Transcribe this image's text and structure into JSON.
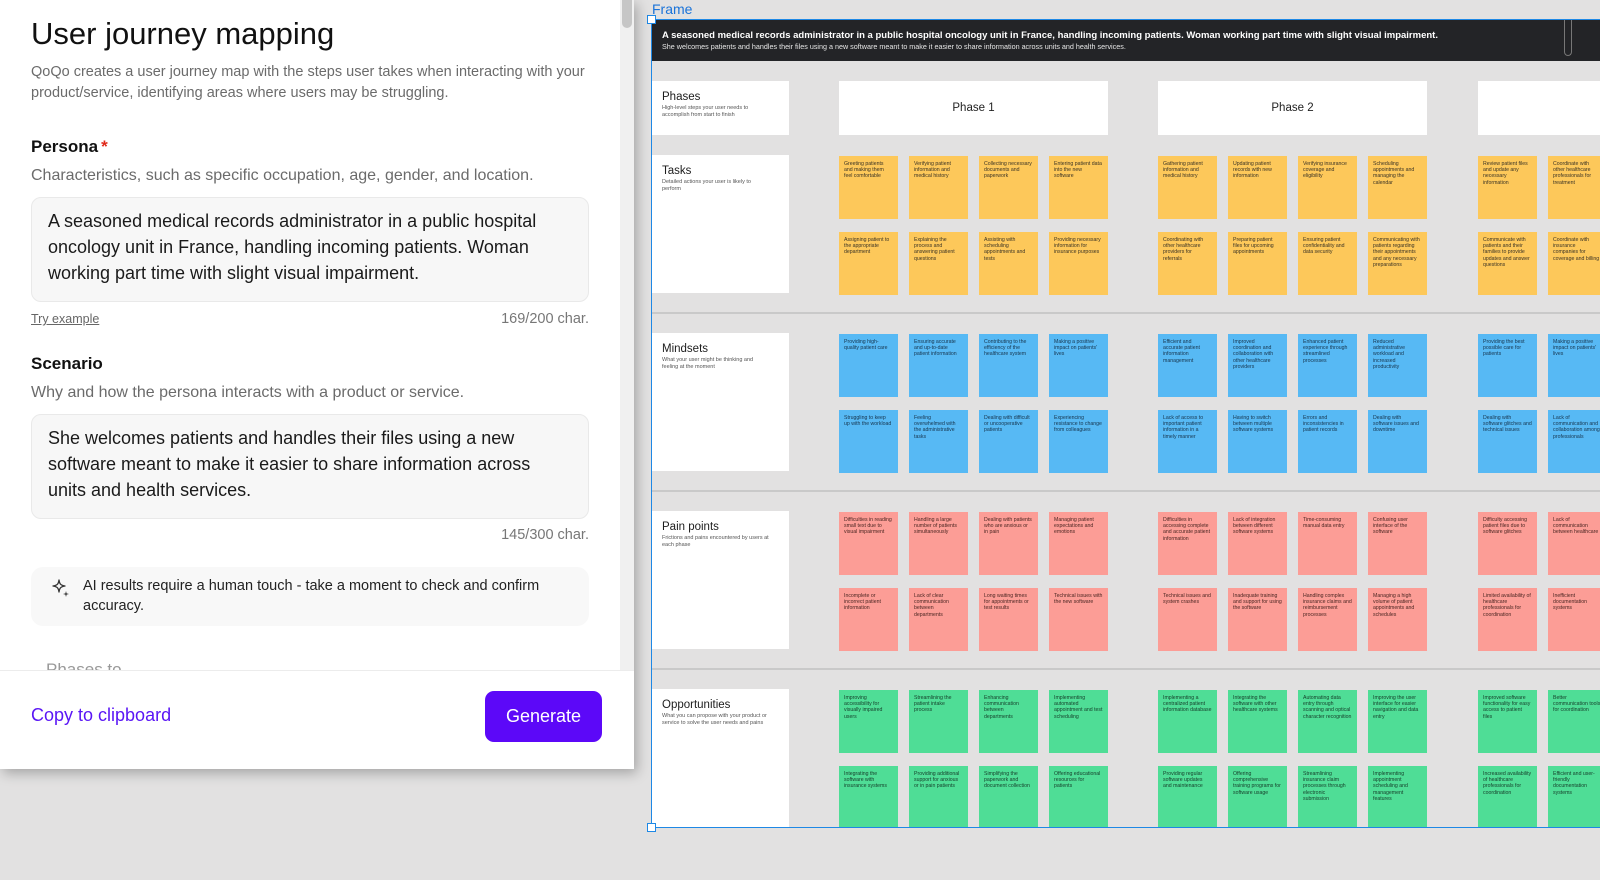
{
  "panel": {
    "title": "User journey mapping",
    "subtitle": "QoQo creates a user journey map with the steps user takes when interacting with your product/service, identifying areas where users may be struggling.",
    "persona": {
      "label": "Persona",
      "required_mark": "*",
      "description": "Characteristics, such as specific occupation, age, gender, and location.",
      "value": "A seasoned medical records administrator in a public hospital oncology unit in France, handling incoming patients. Woman working part time with slight visual impairment.",
      "try_example": "Try example",
      "counter": "169/200 char."
    },
    "scenario": {
      "label": "Scenario",
      "description": "Why and how the persona interacts with a product or service.",
      "value": "She welcomes patients and handles their files using a new software meant to make it easier to share information across units and health services.",
      "counter": "145/300 char."
    },
    "ai_note": "AI results require a human touch - take a moment to check and confirm accuracy.",
    "next_section_cutoff": "Phases to ...",
    "footer": {
      "copy_label": "Copy to clipboard",
      "generate_label": "Generate"
    },
    "colors": {
      "accent": "#5c08f8",
      "required": "#e0281a"
    }
  },
  "canvas": {
    "frame_label": "Frame",
    "banner": {
      "persona": "A seasoned medical records administrator in a public hospital oncology unit in France, handling incoming patients. Woman working part time with slight visual impairment.",
      "scenario": "She welcomes patients and handles their files using a new software meant to make it easier to share information across units and health services."
    },
    "lanes": {
      "phases": {
        "title": "Phases",
        "desc": "High-level steps your user needs to accomplish from start to finish"
      },
      "tasks": {
        "title": "Tasks",
        "desc": "Detailed actions your user is likely to perform"
      },
      "mindsets": {
        "title": "Mindsets",
        "desc": "What your user might be thinking and feeling at the moment"
      },
      "pains": {
        "title": "Pain points",
        "desc": "Frictions and pains encountered by users at each phase"
      },
      "opps": {
        "title": "Opportunities",
        "desc": "What you can propose with your product or service to solve the user needs and pains"
      }
    },
    "phases": [
      "Phase 1",
      "Phase 2",
      ""
    ],
    "stickies": {
      "tasks": [
        [
          "Greeting patients and making them feel comfortable",
          "Verifying patient information and medical history",
          "Collecting necessary documents and paperwork",
          "Entering patient data into the new software",
          "Assigning patient to the appropriate department",
          "Explaining the process and answering patient questions",
          "Assisting with scheduling appointments and tests",
          "Providing necessary information for insurance purposes"
        ],
        [
          "Gathering patient information and medical history",
          "Updating patient records with new information",
          "Verifying insurance coverage and eligibility",
          "Scheduling appointments and managing the calendar",
          "Coordinating with other healthcare providers for referrals",
          "Preparing patient files for upcoming appointments",
          "Ensuring patient confidentiality and data security",
          "Communicating with patients regarding their appointments and any necessary preparations"
        ],
        [
          "Review patient files and update any necessary information",
          "Coordinate with other healthcare professionals for treatment",
          "",
          "",
          "Communicate with patients and their families to provide updates and answer questions",
          "Coordinate with insurance companies for coverage and billing",
          "",
          ""
        ]
      ],
      "mindsets": [
        [
          "Providing high-quality patient care",
          "Ensuring accurate and up-to-date patient information",
          "Contributing to the efficiency of the healthcare system",
          "Making a positive impact on patients' lives",
          "Struggling to keep up with the workload",
          "Feeling overwhelmed with the administrative tasks",
          "Dealing with difficult or uncooperative patients",
          "Experiencing resistance to change from colleagues"
        ],
        [
          "Efficient and accurate patient information management",
          "Improved coordination and collaboration with other healthcare providers",
          "Enhanced patient experience through streamlined processes",
          "Reduced administrative workload and increased productivity",
          "Lack of access to important patient information in a timely manner",
          "Having to switch between multiple software systems",
          "Errors and inconsistencies in patient records",
          "Dealing with software issues and downtime"
        ],
        [
          "Providing the best possible care for patients",
          "Making a positive impact on patients' lives",
          "",
          "",
          "Dealing with software glitches and technical issues",
          "Lack of communication and collaboration among professionals",
          "",
          ""
        ]
      ],
      "pains": [
        [
          "Difficulties in reading small text due to visual impairment",
          "Handling a large number of patients simultaneously",
          "Dealing with patients who are anxious or in pain",
          "Managing patient expectations and emotions",
          "Incomplete or incorrect patient information",
          "Lack of clear communication between departments",
          "Long waiting times for appointments or test results",
          "Technical issues with the new software"
        ],
        [
          "Difficulties in accessing complete and accurate patient information",
          "Lack of integration between different software systems",
          "Time-consuming manual data entry",
          "Confusing user interface of the software",
          "Technical issues and system crashes",
          "Inadequate training and support for using the software",
          "Handling complex insurance claims and reimbursement processes",
          "Managing a high volume of patient appointments and schedules"
        ],
        [
          "Difficulty accessing patient files due to software glitches",
          "Lack of communication between healthcare",
          "",
          "",
          "Limited availability of healthcare professionals for coordination",
          "Inefficient documentation systems",
          "",
          ""
        ]
      ],
      "opps": [
        [
          "Improving accessibility for visually impaired users",
          "Streamlining the patient intake process",
          "Enhancing communication between departments",
          "Implementing automated appointment and test scheduling",
          "Integrating the software with insurance systems",
          "Providing additional support for anxious or in pain patients",
          "Simplifying the paperwork and document collection",
          "Offering educational resources for patients"
        ],
        [
          "Implementing a centralized patient information database",
          "Integrating the software with other healthcare systems",
          "Automating data entry through scanning and optical character recognition",
          "Improving the user interface for easier navigation and data entry",
          "Providing regular software updates and maintenance",
          "Offering comprehensive training programs for software usage",
          "Streamlining insurance claim processes through electronic submission",
          "Implementing appointment scheduling and management features"
        ],
        [
          "Improved software functionality for easy access to patient files",
          "Better communication tools for coordination",
          "",
          "",
          "Increased availability of healthcare professionals for coordination",
          "Efficient and user-friendly documentation systems",
          "",
          ""
        ]
      ]
    },
    "sticky_colors": {
      "tasks": "#fdc85a",
      "mindsets": "#57b9f4",
      "pains": "#fc9d96",
      "opps": "#4fdd96"
    }
  }
}
